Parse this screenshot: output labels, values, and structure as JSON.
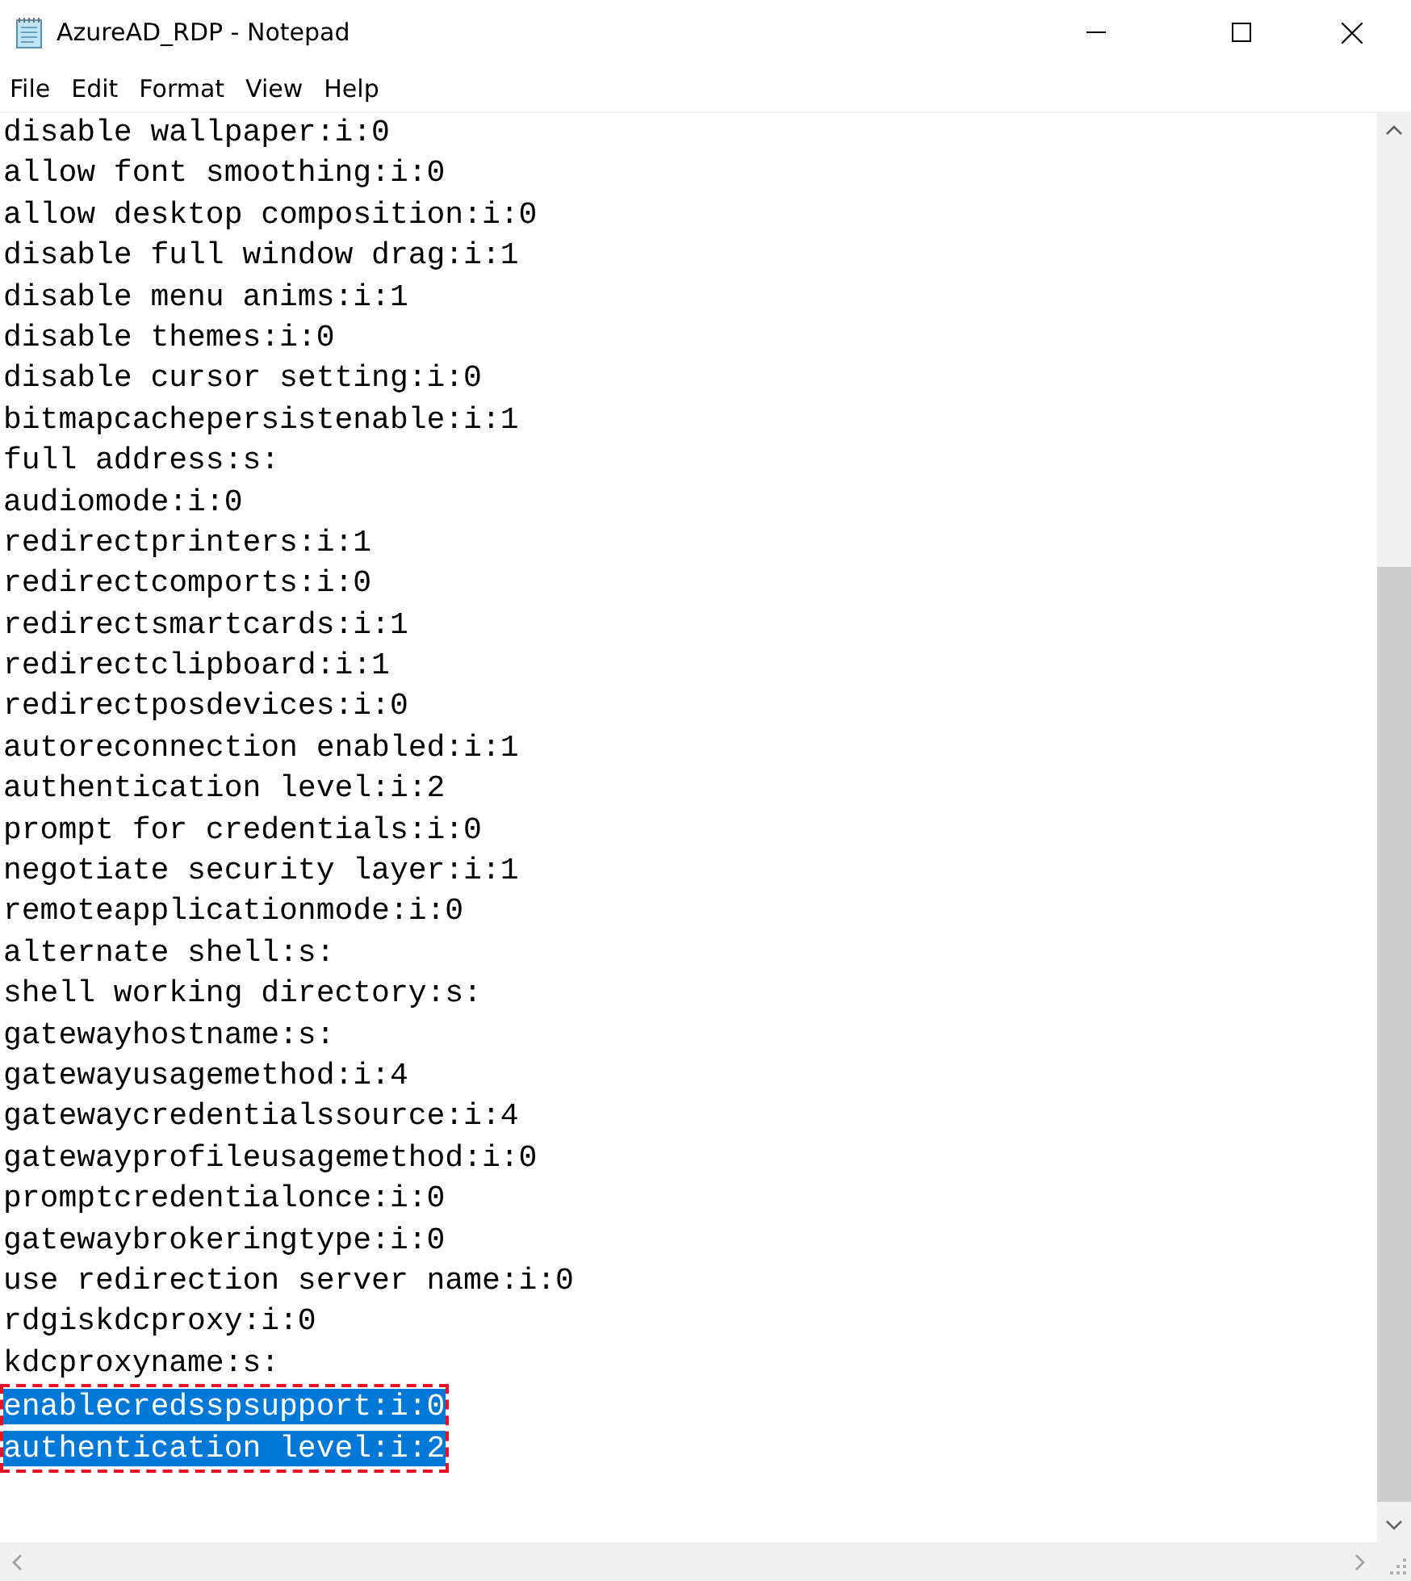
{
  "window": {
    "title": "AzureAD_RDP - Notepad"
  },
  "menu": [
    "File",
    "Edit",
    "Format",
    "View",
    "Help"
  ],
  "lines": [
    {
      "text": "disable wallpaper:i:0",
      "selected": false
    },
    {
      "text": "allow font smoothing:i:0",
      "selected": false
    },
    {
      "text": "allow desktop composition:i:0",
      "selected": false
    },
    {
      "text": "disable full window drag:i:1",
      "selected": false
    },
    {
      "text": "disable menu anims:i:1",
      "selected": false
    },
    {
      "text": "disable themes:i:0",
      "selected": false
    },
    {
      "text": "disable cursor setting:i:0",
      "selected": false
    },
    {
      "text": "bitmapcachepersistenable:i:1",
      "selected": false
    },
    {
      "text": "full address:s:",
      "selected": false
    },
    {
      "text": "audiomode:i:0",
      "selected": false
    },
    {
      "text": "redirectprinters:i:1",
      "selected": false
    },
    {
      "text": "redirectcomports:i:0",
      "selected": false
    },
    {
      "text": "redirectsmartcards:i:1",
      "selected": false
    },
    {
      "text": "redirectclipboard:i:1",
      "selected": false
    },
    {
      "text": "redirectposdevices:i:0",
      "selected": false
    },
    {
      "text": "autoreconnection enabled:i:1",
      "selected": false
    },
    {
      "text": "authentication level:i:2",
      "selected": false
    },
    {
      "text": "prompt for credentials:i:0",
      "selected": false
    },
    {
      "text": "negotiate security layer:i:1",
      "selected": false
    },
    {
      "text": "remoteapplicationmode:i:0",
      "selected": false
    },
    {
      "text": "alternate shell:s:",
      "selected": false
    },
    {
      "text": "shell working directory:s:",
      "selected": false
    },
    {
      "text": "gatewayhostname:s:",
      "selected": false
    },
    {
      "text": "gatewayusagemethod:i:4",
      "selected": false
    },
    {
      "text": "gatewaycredentialssource:i:4",
      "selected": false
    },
    {
      "text": "gatewayprofileusagemethod:i:0",
      "selected": false
    },
    {
      "text": "promptcredentialonce:i:0",
      "selected": false
    },
    {
      "text": "gatewaybrokeringtype:i:0",
      "selected": false
    },
    {
      "text": "use redirection server name:i:0",
      "selected": false
    },
    {
      "text": "rdgiskdcproxy:i:0",
      "selected": false
    },
    {
      "text": "kdcproxyname:s:",
      "selected": false
    },
    {
      "text": "enablecredsspsupport:i:0",
      "selected": true
    },
    {
      "text": "authentication level:i:2",
      "selected": true
    }
  ]
}
